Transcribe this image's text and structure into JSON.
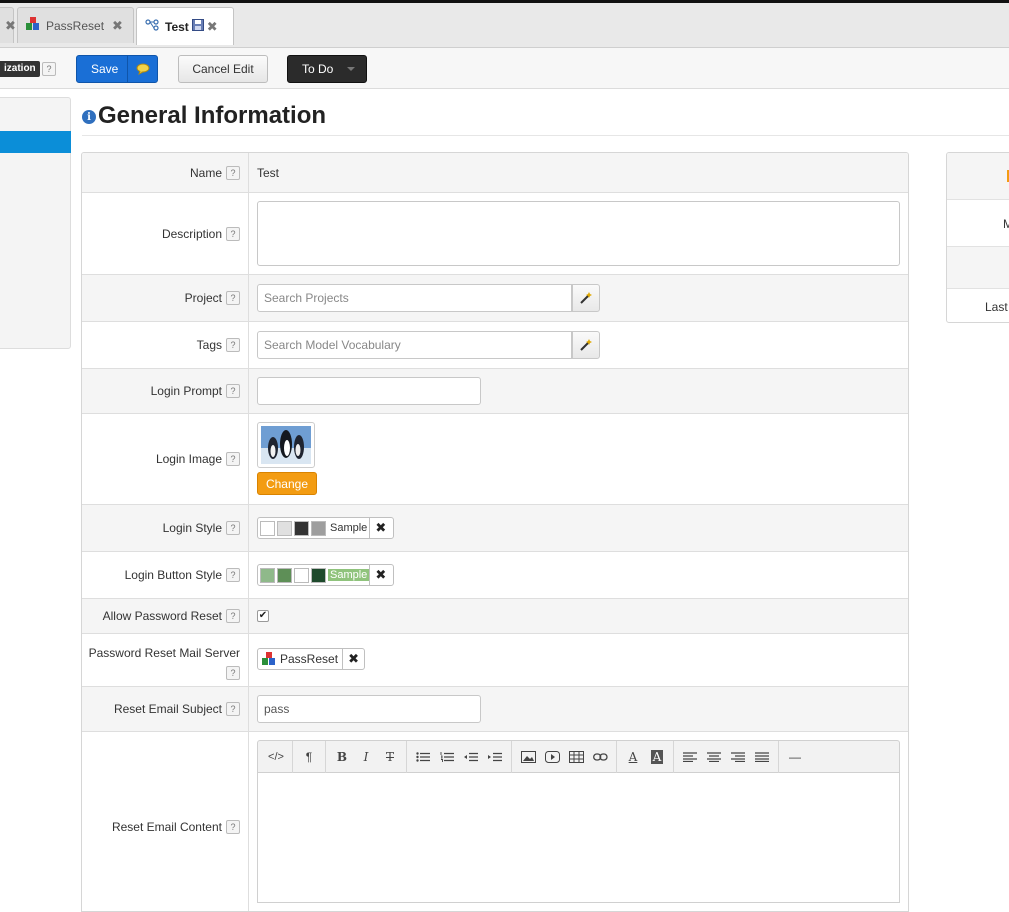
{
  "tabs": [
    {
      "label": "PassReset",
      "icon": "blocks-icon"
    },
    {
      "label": "Test",
      "icon": "flow-icon",
      "active": true
    }
  ],
  "toolbar": {
    "badge": "ization",
    "help": "?",
    "save_label": "Save",
    "cancel_label": "Cancel Edit",
    "todo_label": "To Do"
  },
  "heading": "General Information",
  "help_glyph": "?",
  "form": {
    "name": {
      "label": "Name",
      "value": "Test"
    },
    "description": {
      "label": "Description",
      "value": ""
    },
    "project": {
      "label": "Project",
      "placeholder": "Search Projects"
    },
    "tags": {
      "label": "Tags",
      "placeholder": "Search Model Vocabulary"
    },
    "login_prompt": {
      "label": "Login Prompt",
      "value": ""
    },
    "login_image": {
      "label": "Login Image",
      "change_label": "Change"
    },
    "login_style": {
      "label": "Login Style",
      "sample": "Sample",
      "colors": [
        "#ffffff",
        "#e0e0e0",
        "#333333",
        "#9e9e9e"
      ]
    },
    "login_button_style": {
      "label": "Login Button Style",
      "sample": "Sample",
      "colors": [
        "#8fb98a",
        "#5e8f57",
        "#ffffff",
        "#1e4a2c"
      ],
      "sample_bg": "#8fc37c",
      "sample_color": "#ffffff"
    },
    "allow_password_reset": {
      "label": "Allow Password Reset",
      "checked": true
    },
    "mail_server": {
      "label": "Password Reset Mail Server",
      "value": "PassReset"
    },
    "reset_subject": {
      "label": "Reset Email Subject",
      "value": "pass"
    },
    "reset_content": {
      "label": "Reset Email Content"
    }
  },
  "rte_tools": [
    "</>",
    "¶",
    "B",
    "I",
    "T",
    "ul",
    "ol",
    "outdent",
    "indent",
    "image",
    "video",
    "table",
    "link",
    "A",
    "A",
    "left",
    "center",
    "right",
    "justify",
    "—"
  ],
  "right_panel": {
    "row2": "M",
    "row4": "Last"
  }
}
